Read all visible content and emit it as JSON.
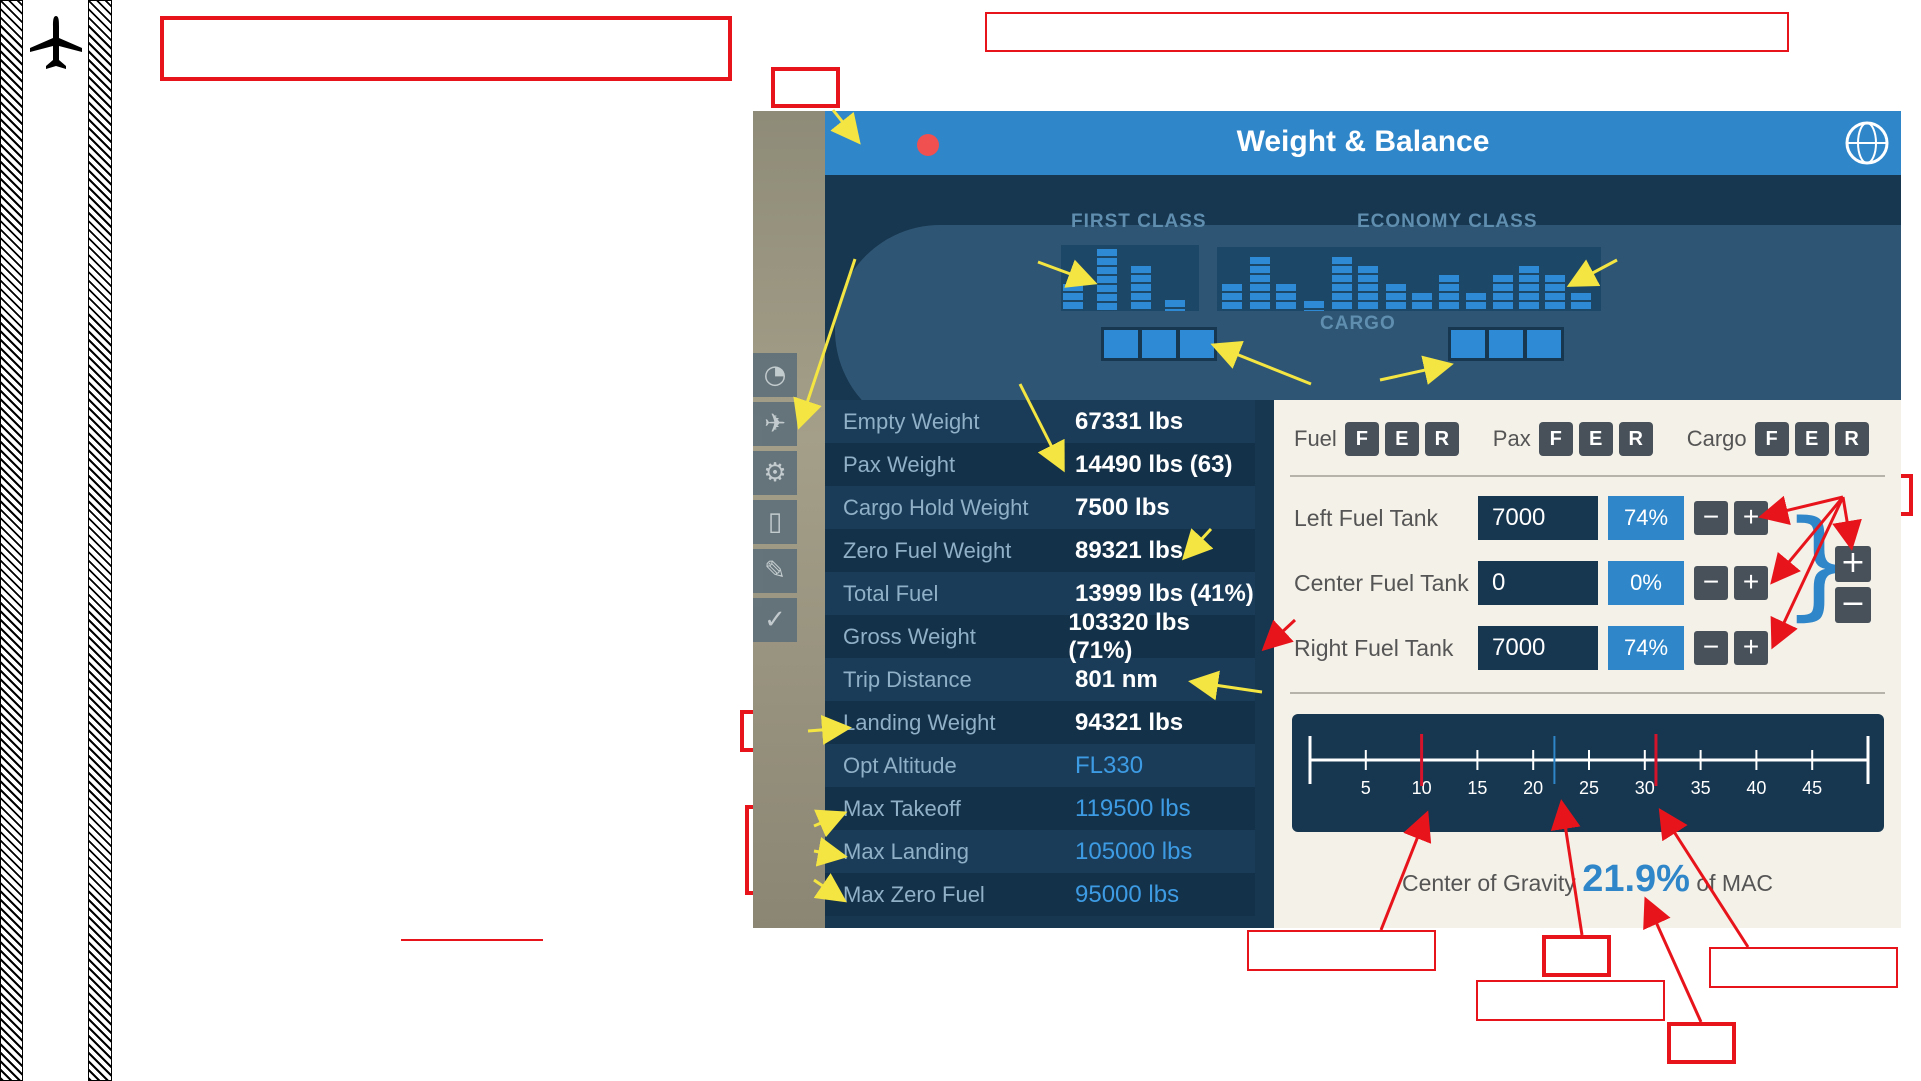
{
  "window": {
    "title": "Weight & Balance"
  },
  "seatmap": {
    "first_class_label": "FIRST CLASS",
    "economy_class_label": "ECONOMY CLASS",
    "cargo_label": "CARGO"
  },
  "stats": [
    {
      "label": "Empty Weight",
      "value": "67331 lbs",
      "highlight": false
    },
    {
      "label": "Pax Weight",
      "value": "14490 lbs (63)",
      "highlight": false
    },
    {
      "label": "Cargo Hold Weight",
      "value": "7500 lbs",
      "highlight": false
    },
    {
      "label": "Zero Fuel Weight",
      "value": "89321 lbs",
      "highlight": false
    },
    {
      "label": "Total Fuel",
      "value": "13999 lbs (41%)",
      "highlight": false
    },
    {
      "label": "Gross Weight",
      "value": "103320 lbs (71%)",
      "highlight": false
    },
    {
      "label": "Trip Distance",
      "value": "801 nm",
      "highlight": false
    },
    {
      "label": "Landing Weight",
      "value": "94321 lbs",
      "highlight": false
    },
    {
      "label": "Opt Altitude",
      "value": "FL330",
      "highlight": true
    },
    {
      "label": "Max Takeoff",
      "value": "119500 lbs",
      "highlight": true
    },
    {
      "label": "Max Landing",
      "value": "105000 lbs",
      "highlight": true
    },
    {
      "label": "Max Zero Fuel",
      "value": "95000 lbs",
      "highlight": true
    }
  ],
  "tabs": {
    "fuel": {
      "label": "Fuel",
      "buttons": [
        "F",
        "E",
        "R"
      ]
    },
    "pax": {
      "label": "Pax",
      "buttons": [
        "F",
        "E",
        "R"
      ]
    },
    "cargo": {
      "label": "Cargo",
      "buttons": [
        "F",
        "E",
        "R"
      ]
    }
  },
  "tanks": [
    {
      "label": "Left Fuel Tank",
      "value": "7000",
      "percent": "74%"
    },
    {
      "label": "Center Fuel Tank",
      "value": "0",
      "percent": "0%"
    },
    {
      "label": "Right Fuel Tank",
      "value": "7000",
      "percent": "74%"
    }
  ],
  "step_symbols": {
    "minus": "−",
    "plus": "+",
    "bracket": "}"
  },
  "cg": {
    "label": "Center of Gravity",
    "value": "21.9%",
    "suffix": "of MAC",
    "ticks": [
      "5",
      "10",
      "15",
      "20",
      "25",
      "30",
      "35",
      "40",
      "45"
    ],
    "scale_min": 0,
    "scale_max": 50,
    "fwd_limit": 10,
    "current": 21.9,
    "aft_limit": 31
  },
  "colors": {
    "accent": "#2f86c9",
    "panel_dark": "#17364f",
    "callout_red": "#e8141c",
    "pointer_yellow": "#f4e542"
  },
  "icons": {
    "sidebar": [
      "plane-icon"
    ],
    "side_menu": [
      "gauge-icon",
      "plane-icon",
      "gear-icon",
      "door-icon",
      "wrench-icon",
      "checklist-icon"
    ],
    "titlebar": [
      "globe-icon"
    ]
  }
}
